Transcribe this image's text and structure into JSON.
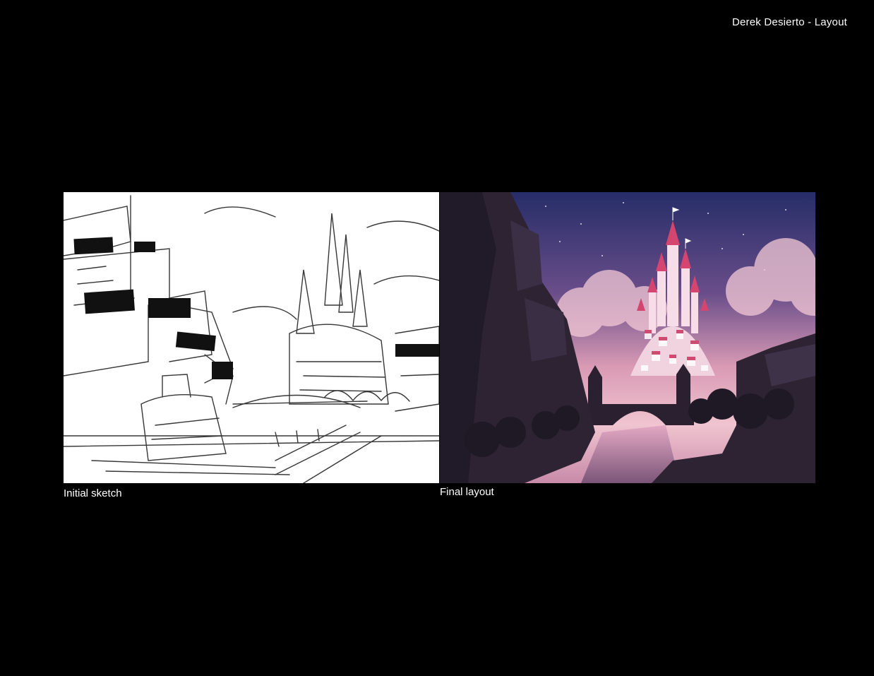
{
  "header": {
    "credit": "Derek Desierto - Layout"
  },
  "panels": [
    {
      "caption": "Initial sketch",
      "image": "castle-town-pencil-sketch"
    },
    {
      "caption": "Final layout",
      "image": "castle-town-night-painting"
    }
  ],
  "colors": {
    "background": "#000000",
    "text": "#ffffff",
    "sky_top": "#2a2f6b",
    "sky_glow": "#e8b0c0",
    "castle": "#f4d6e2",
    "roof": "#d8456f",
    "silhouette": "#2a2030"
  }
}
